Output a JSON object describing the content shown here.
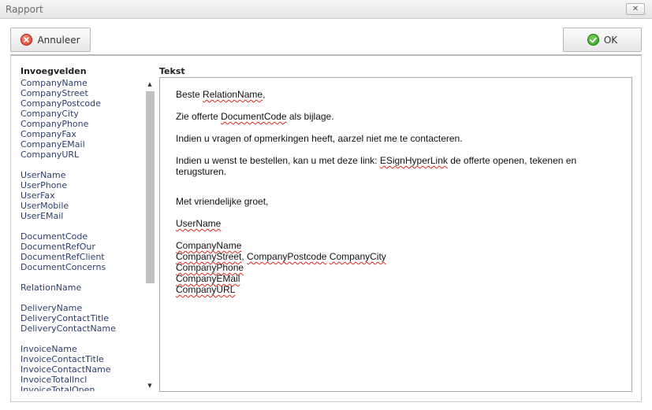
{
  "window": {
    "title": "Rapport",
    "close_glyph": "✕"
  },
  "toolbar": {
    "cancel_label": "Annuleer",
    "ok_label": "OK"
  },
  "fields": {
    "heading": "Invoegvelden",
    "items": [
      "CompanyName",
      "CompanyStreet",
      "CompanyPostcode",
      "CompanyCity",
      "CompanyPhone",
      "CompanyFax",
      "CompanyEMail",
      "CompanyURL",
      "UserName",
      "UserPhone",
      "UserFax",
      "UserMobile",
      "UserEMail",
      "DocumentCode",
      "DocumentRefOur",
      "DocumentRefClient",
      "DocumentConcerns",
      "RelationName",
      "DeliveryName",
      "DeliveryContactTitle",
      "DeliveryContactName",
      "InvoiceName",
      "InvoiceContactTitle",
      "InvoiceContactName",
      "InvoiceTotalIncl",
      "InvoiceTotalOpen"
    ]
  },
  "editor": {
    "label": "Tekst",
    "greeting_pre": "Beste ",
    "greeting_var": "RelationName",
    "greeting_post": ",",
    "line2_pre": "Zie offerte ",
    "line2_var": "DocumentCode",
    "line2_post": " als bijlage.",
    "line3": "Indien u vragen of opmerkingen heeft, aarzel niet me te contacteren.",
    "line4_pre": "Indien u wenst te bestellen, kan u met deze link: ",
    "line4_var": "ESignHyperLink",
    "line4_post": " de offerte openen, tekenen en terugsturen.",
    "closing": "Met vriendelijke groet,",
    "user_var": "UserName",
    "sig_name": "CompanyName",
    "sig_street": "CompanyStreet",
    "sig_comma": ", ",
    "sig_postcode": "CompanyPostcode",
    "sig_space": " ",
    "sig_city": "CompanyCity",
    "sig_phone": "CompanyPhone",
    "sig_email": "CompanyEMail",
    "sig_url": "CompanyURL"
  }
}
